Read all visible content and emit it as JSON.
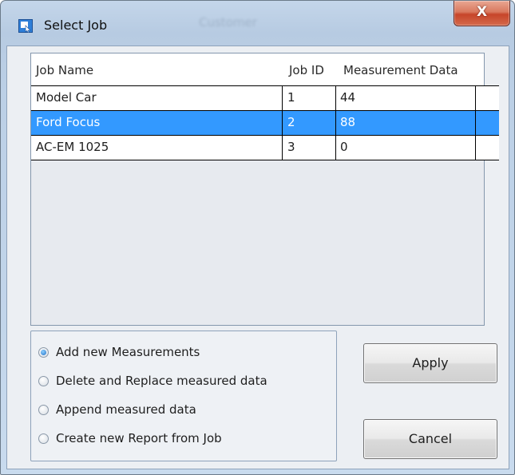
{
  "window": {
    "title": "Select Job",
    "background_title_ghost": "Customer",
    "close_label": "X"
  },
  "grid": {
    "columns": [
      "Job Name",
      "Job ID",
      "Measurement Data"
    ],
    "rows": [
      {
        "name": "Model Car",
        "id": "1",
        "data": "44"
      },
      {
        "name": "Ford Focus",
        "id": "2",
        "data": "88",
        "selected": true
      },
      {
        "name": "AC-EM 1025",
        "id": "3",
        "data": "0"
      }
    ]
  },
  "options": [
    {
      "label": "Add new Measurements",
      "checked": true
    },
    {
      "label": "Delete and Replace measured data",
      "checked": false
    },
    {
      "label": "Append measured data",
      "checked": false
    },
    {
      "label": "Create new Report from Job",
      "checked": false
    }
  ],
  "buttons": {
    "apply": "Apply",
    "cancel": "Cancel"
  },
  "colors": {
    "selection": "#3399ff",
    "close_button": "#c7452a",
    "window_frame": "#bcd0e6"
  }
}
